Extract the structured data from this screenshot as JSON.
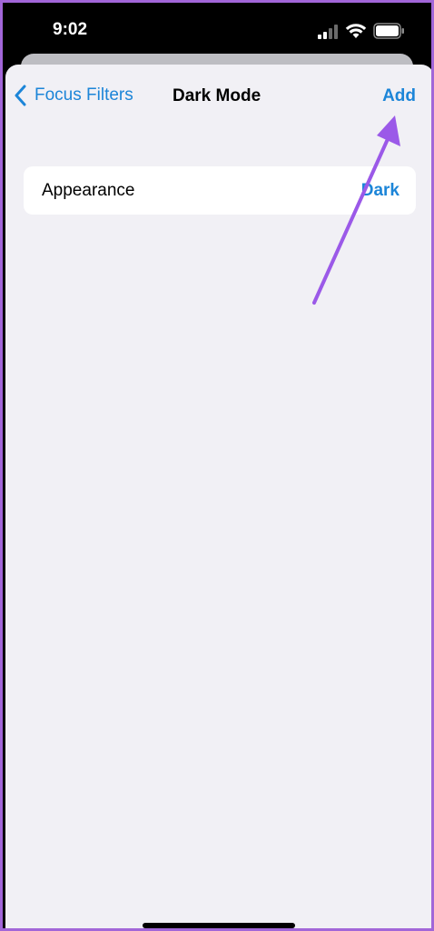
{
  "status_bar": {
    "time": "9:02",
    "signal_icon": "cellular-signal-icon",
    "wifi_icon": "wifi-icon",
    "battery_icon": "battery-icon"
  },
  "nav": {
    "back_label": "Focus Filters",
    "back_icon": "chevron-left-icon",
    "title": "Dark Mode",
    "add_label": "Add"
  },
  "settings": {
    "rows": [
      {
        "label": "Appearance",
        "value": "Dark"
      }
    ]
  },
  "annotation": {
    "type": "arrow",
    "color": "#9b59e8",
    "points_to": "add-button"
  },
  "colors": {
    "accent": "#1c85d8",
    "background": "#f1f0f5",
    "frame_border": "#a266d8"
  }
}
